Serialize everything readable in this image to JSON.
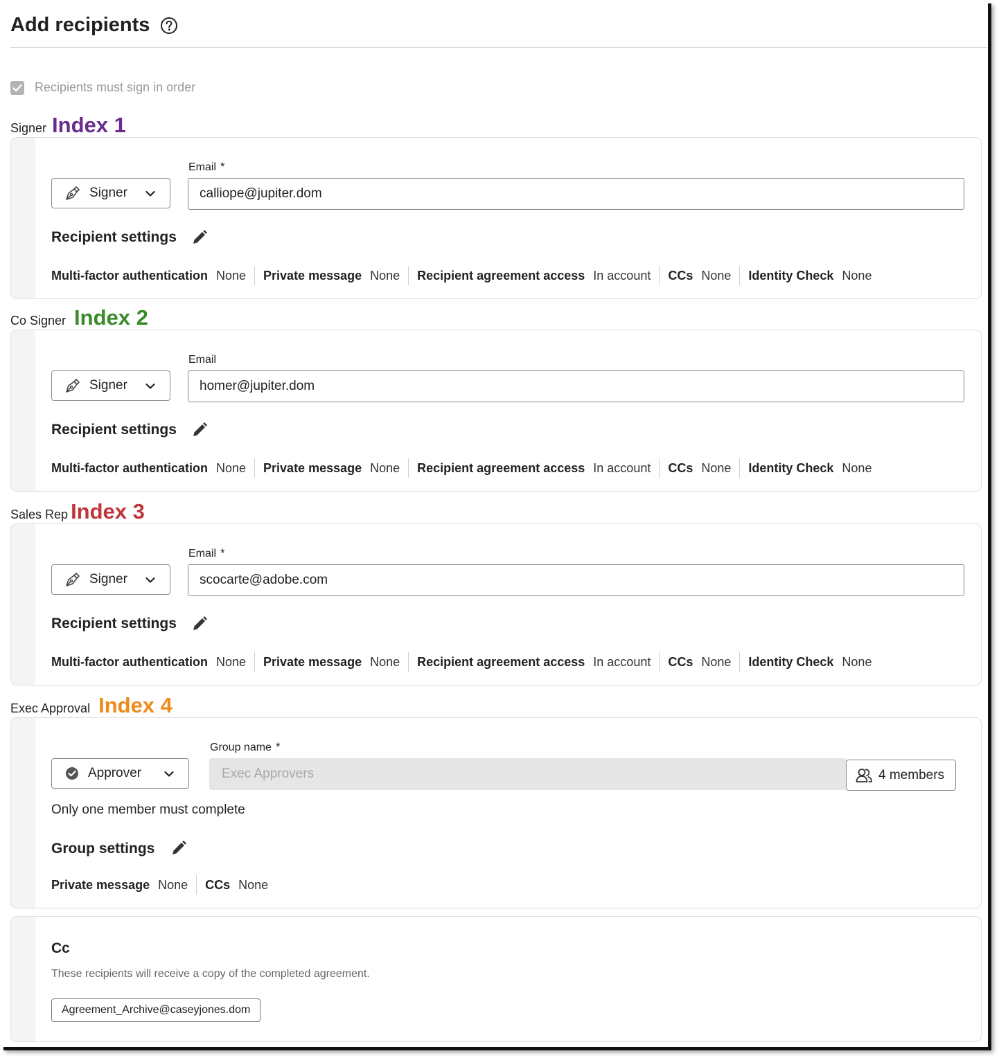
{
  "page": {
    "title": "Add recipients",
    "order_checkbox": {
      "label": "Recipients must sign in order",
      "checked": true
    }
  },
  "recipients": [
    {
      "role_name": "Signer",
      "index_label": "Index 1",
      "index_color": "#6a2b8e",
      "role_select": "Signer",
      "email_label": "Email",
      "required": "*",
      "email": "calliope@jupiter.dom",
      "settings_title": "Recipient settings",
      "settings": [
        {
          "key": "Multi-factor authentication",
          "value": "None"
        },
        {
          "key": "Private message",
          "value": "None"
        },
        {
          "key": "Recipient agreement access",
          "value": "In account"
        },
        {
          "key": "CCs",
          "value": "None"
        },
        {
          "key": "Identity Check",
          "value": "None"
        }
      ]
    },
    {
      "role_name": "Co Signer",
      "index_label": "Index 2",
      "index_color": "#3a8a2a",
      "role_select": "Signer",
      "email_label": "Email",
      "required": "",
      "email": "homer@jupiter.dom",
      "settings_title": "Recipient settings",
      "settings": [
        {
          "key": "Multi-factor authentication",
          "value": "None"
        },
        {
          "key": "Private message",
          "value": "None"
        },
        {
          "key": "Recipient agreement access",
          "value": "In account"
        },
        {
          "key": "CCs",
          "value": "None"
        },
        {
          "key": "Identity Check",
          "value": "None"
        }
      ]
    },
    {
      "role_name": "Sales Rep",
      "index_label": "Index 3",
      "index_color": "#c0353a",
      "role_select": "Signer",
      "email_label": "Email",
      "required": "*",
      "email": "scocarte@adobe.com",
      "settings_title": "Recipient settings",
      "settings": [
        {
          "key": "Multi-factor authentication",
          "value": "None"
        },
        {
          "key": "Private message",
          "value": "None"
        },
        {
          "key": "Recipient agreement access",
          "value": "In account"
        },
        {
          "key": "CCs",
          "value": "None"
        },
        {
          "key": "Identity Check",
          "value": "None"
        }
      ]
    }
  ],
  "approval": {
    "role_name": "Exec Approval",
    "index_label": "Index 4",
    "index_color": "#ee8a1a",
    "role_select": "Approver",
    "group_label": "Group name",
    "required": "*",
    "group_placeholder": "Exec Approvers",
    "members_button": "4 members",
    "completion_note": "Only one member must complete",
    "settings_title": "Group settings",
    "settings": [
      {
        "key": "Private message",
        "value": "None"
      },
      {
        "key": "CCs",
        "value": "None"
      }
    ]
  },
  "cc": {
    "title": "Cc",
    "description": "These recipients will receive a copy of the completed agreement.",
    "chips": [
      "Agreement_Archive@caseyjones.dom"
    ]
  }
}
